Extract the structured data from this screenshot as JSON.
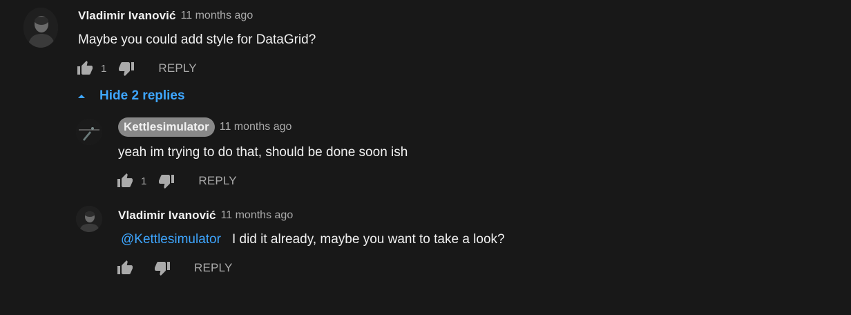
{
  "comments": [
    {
      "author": "Vladimir Ivanović",
      "time": "11 months ago",
      "text": "Maybe you could add style for DataGrid?",
      "likes": "1",
      "reply_label": "REPLY",
      "avatar_icon": "person-portrait"
    }
  ],
  "replies_toggle": {
    "label": "Hide 2 replies",
    "icon": "caret-up-icon"
  },
  "replies": [
    {
      "author": "Kettlesimulator",
      "author_highlighted": true,
      "time": "11 months ago",
      "text": "yeah im trying to do that, should be done soon ish",
      "likes": "1",
      "reply_label": "REPLY",
      "avatar_icon": "channel-logo"
    },
    {
      "author": "Vladimir Ivanović",
      "time": "11 months ago",
      "mention": "@Kettlesimulator",
      "text": "I did it already, maybe you want to take a look?",
      "likes": "",
      "reply_label": "REPLY",
      "avatar_icon": "person-portrait"
    }
  ],
  "colors": {
    "background": "#181818",
    "link": "#3ea6ff",
    "secondary_text": "#aaaaaa",
    "primary_text": "#f1f1f1",
    "author_chip": "#888888"
  }
}
